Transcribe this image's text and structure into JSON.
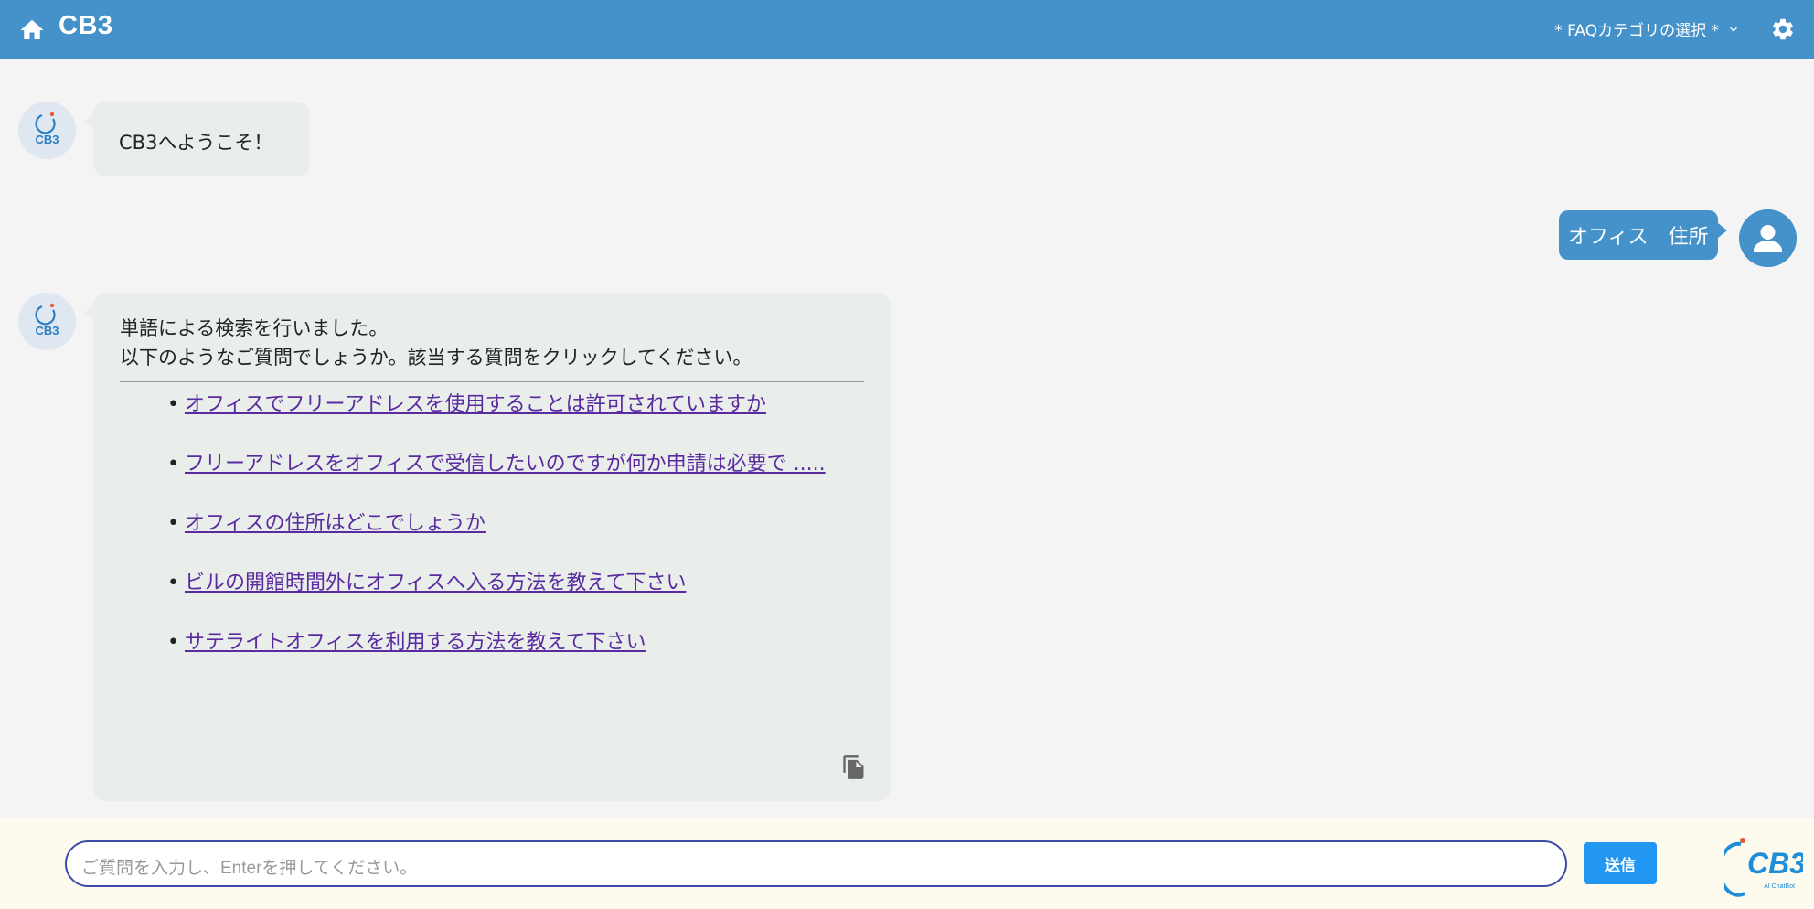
{
  "header": {
    "title": "CB3",
    "category_select": "* FAQカテゴリの選択 *",
    "icons": [
      "home-icon",
      "chevron-down-icon",
      "gear-icon"
    ]
  },
  "chat": {
    "bot_avatar_text": "CB3",
    "welcome": "CB3へようこそ！",
    "user_message": "オフィス　住所",
    "answer": {
      "line1": "単語による検索を行いました。",
      "line2": "以下のようなご質問でしょうか。該当する質問をクリックしてください。",
      "faqs": [
        "オフィスでフリーアドレスを使用することは許可されていますか",
        "フリーアドレスをオフィスで受信したいのですが何か申請は必要で .....",
        "オフィスの住所はどこでしょうか",
        "ビルの開館時間外にオフィスへ入る方法を教えて下さい",
        "サテライトオフィスを利用する方法を教えて下さい"
      ]
    }
  },
  "footer": {
    "input_placeholder": "ご質問を入力し、Enterを押してください。",
    "send_label": "送信",
    "logo_text": "CB3",
    "logo_subtext": "AI ChatBot"
  },
  "colors": {
    "header": "#4592ca",
    "bot_bubble": "#e9eeeb",
    "user_bubble": "#4592ca",
    "link": "#5a2aa0",
    "send_button": "#2196f3",
    "footer": "#fdfaee"
  }
}
